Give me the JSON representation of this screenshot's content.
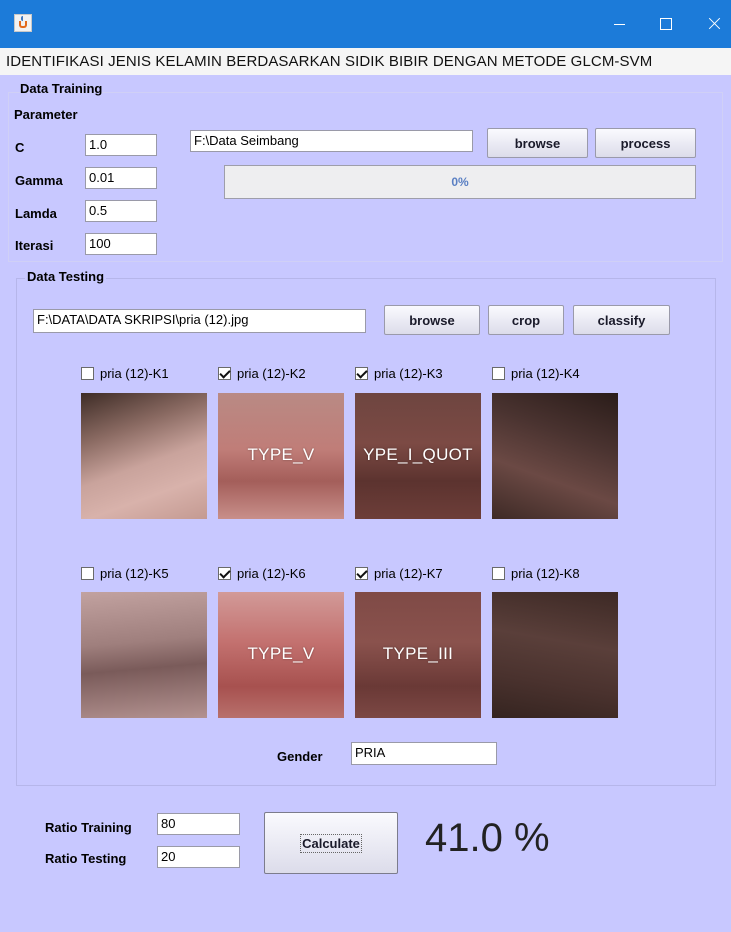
{
  "window": {
    "min_icon": "minimize-icon",
    "max_icon": "maximize-icon",
    "close_icon": "close-icon",
    "title_bar_color": "#1c7bd9"
  },
  "app_title": "IDENTIFIKASI JENIS KELAMIN BERDASARKAN SIDIK BIBIR DENGAN METODE GLCM-SVM",
  "training": {
    "section_label": "Data Training",
    "parameter_label": "Parameter",
    "params": [
      {
        "label": "C",
        "value": "1.0"
      },
      {
        "label": "Gamma",
        "value": "0.01"
      },
      {
        "label": "Lamda",
        "value": "0.5"
      },
      {
        "label": "Iterasi",
        "value": "100"
      }
    ],
    "path": "F:\\Data Seimbang",
    "browse_label": "browse",
    "process_label": "process",
    "progress_text": "0%",
    "progress": 0
  },
  "testing": {
    "section_label": "Data Testing",
    "path": "F:\\DATA\\DATA SKRIPSI\\pria (12).jpg",
    "browse_label": "browse",
    "crop_label": "crop",
    "classify_label": "classify",
    "crops": [
      {
        "label": "pria (12)-K1",
        "checked": false,
        "overlay": "",
        "tone": "#b9928a"
      },
      {
        "label": "pria (12)-K2",
        "checked": true,
        "overlay": "TYPE_V",
        "tone": "#b0716c"
      },
      {
        "label": "pria (12)-K3",
        "checked": true,
        "overlay": "YPE_I_QUOT",
        "tone": "#73433c"
      },
      {
        "label": "pria (12)-K4",
        "checked": false,
        "overlay": "",
        "tone": "#5a3c36"
      },
      {
        "label": "pria (12)-K5",
        "checked": false,
        "overlay": "",
        "tone": "#a07f7d"
      },
      {
        "label": "pria (12)-K6",
        "checked": true,
        "overlay": "TYPE_V",
        "tone": "#bc6f6d"
      },
      {
        "label": "pria (12)-K7",
        "checked": true,
        "overlay": "TYPE_III",
        "tone": "#7d4642"
      },
      {
        "label": "pria (12)-K8",
        "checked": false,
        "overlay": "",
        "tone": "#4f3631"
      }
    ],
    "gender_label": "Gender",
    "gender_value": "PRIA"
  },
  "ratio": {
    "training_label": "Ratio Training",
    "training_value": "80",
    "testing_label": "Ratio Testing",
    "testing_value": "20",
    "calculate_label": "Calculate",
    "result": "41.0 %"
  },
  "colors": {
    "panel_bg": "#c8c8ff",
    "progress_text": "#5a7fc3"
  }
}
